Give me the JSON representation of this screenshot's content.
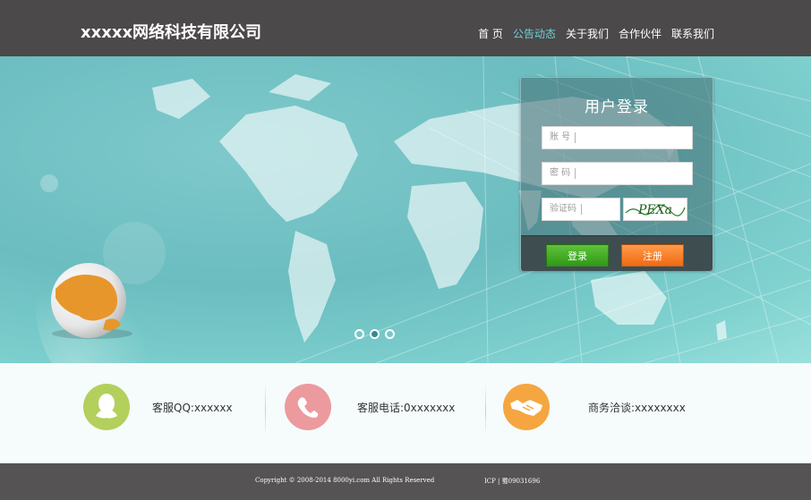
{
  "header": {
    "logo": "xxxxx网络科技有限公司",
    "nav": [
      {
        "label": "首 页"
      },
      {
        "label": "公告动态"
      },
      {
        "label": "关于我们"
      },
      {
        "label": "合作伙伴"
      },
      {
        "label": "联系我们"
      }
    ]
  },
  "banner": {
    "slides_total": 3,
    "active_slide": 2
  },
  "login": {
    "title": "用户登录",
    "account_label": "账 号",
    "password_label": "密 码",
    "captcha_label": "验证码",
    "captcha_text": "PEXa",
    "login_button": "登录",
    "register_button": "注册"
  },
  "contact": {
    "qq": "客服QQ:xxxxxx",
    "phone": "客服电话:0xxxxxxx",
    "business": "商务洽谈:xxxxxxxx"
  },
  "footer": {
    "copyright": "Copyright © 2008-2014 8000yi.com All Rights Reserved",
    "icp": "ICP  | 蜀09031696"
  },
  "colors": {
    "header_bg": "#4b4949",
    "nav_active": "#6fcfd6",
    "qq_icon": "#b3cf5c",
    "phone_icon": "#ec9a9d",
    "handshake_icon": "#f5a640",
    "footer_bg": "#555353"
  }
}
